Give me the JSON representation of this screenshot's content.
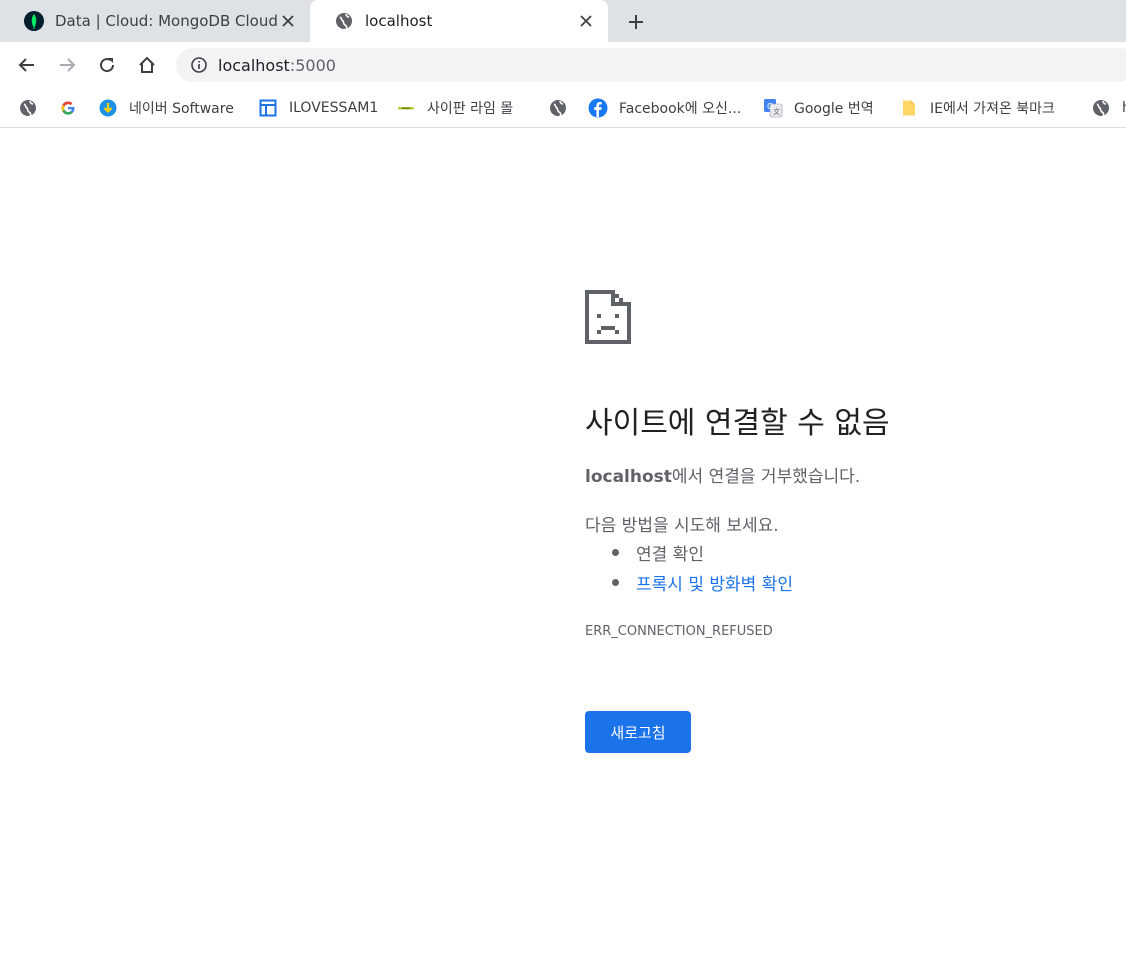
{
  "tabs": [
    {
      "title": "Data | Cloud: MongoDB Cloud",
      "icon": "mongodb-leaf-icon",
      "active": false
    },
    {
      "title": "localhost",
      "icon": "globe-icon",
      "active": true
    }
  ],
  "toolbar": {
    "url_host": "localhost",
    "url_port": ":5000"
  },
  "bookmarks": [
    {
      "label": "",
      "icon": "globe-icon"
    },
    {
      "label": "",
      "icon": "google-icon"
    },
    {
      "label": "네이버 Software",
      "icon": "naver-download-icon"
    },
    {
      "label": "ILOVESSAM1",
      "icon": "layout-icon"
    },
    {
      "label": "사이판 라임 몰",
      "icon": "lime-mall-icon"
    },
    {
      "label": "",
      "icon": "globe-icon"
    },
    {
      "label": "Facebook에 오신...",
      "icon": "facebook-icon"
    },
    {
      "label": "Google 번역",
      "icon": "google-translate-icon"
    },
    {
      "label": "IE에서 가져온 북마크",
      "icon": "folder-icon"
    },
    {
      "label": "h",
      "icon": "globe-icon"
    }
  ],
  "error": {
    "title": "사이트에 연결할 수 없음",
    "host": "localhost",
    "message": "에서 연결을 거부했습니다.",
    "try_heading": "다음 방법을 시도해 보세요.",
    "suggestions": [
      "연결 확인",
      "프록시 및 방화벽 확인"
    ],
    "code": "ERR_CONNECTION_REFUSED",
    "reload_label": "새로고침"
  },
  "colors": {
    "accent": "#1a73e8",
    "tabstrip_bg": "#dee1e6",
    "text_primary": "#202124",
    "text_secondary": "#5f6368"
  }
}
